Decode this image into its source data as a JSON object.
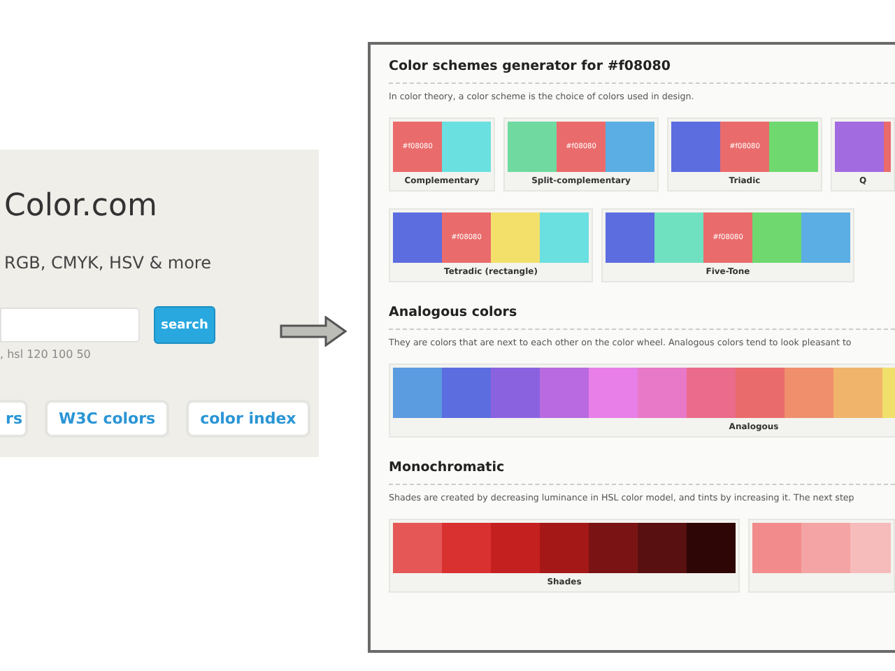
{
  "left_panel": {
    "title": "Color.com",
    "subtitle": "RGB, CMYK, HSV & more",
    "search_hint": ", hsl 120 100 50",
    "search_button": "search",
    "links": [
      "rs",
      "W3C colors",
      "color index"
    ]
  },
  "right_panel": {
    "sections": [
      {
        "heading": "Color schemes generator for #f08080",
        "description": "In color theory, a color scheme is the choice of colors used in design.",
        "card_groups": [
          {
            "cards": [
              {
                "name": "Complementary",
                "swatches": [
                  {
                    "color": "#ea6b6b",
                    "label": "#f08080"
                  },
                  {
                    "color": "#6ae0e0"
                  }
                ]
              },
              {
                "name": "Split-complementary",
                "swatches": [
                  {
                    "color": "#6fd9a0"
                  },
                  {
                    "color": "#ea6b6b",
                    "label": "#f08080"
                  },
                  {
                    "color": "#5aaee3"
                  }
                ]
              },
              {
                "name": "Triadic",
                "swatches": [
                  {
                    "color": "#5c6de0"
                  },
                  {
                    "color": "#ea6b6b",
                    "label": "#f08080"
                  },
                  {
                    "color": "#6fd86f"
                  }
                ]
              },
              {
                "name": "Q",
                "swatches": [
                  {
                    "color": "#a26be0"
                  },
                  {
                    "color": "#ea6b6b"
                  }
                ]
              }
            ]
          },
          {
            "cards": [
              {
                "name": "Tetradic (rectangle)",
                "swatches": [
                  {
                    "color": "#5c6de0"
                  },
                  {
                    "color": "#ea6b6b",
                    "label": "#f08080"
                  },
                  {
                    "color": "#f2e06a"
                  },
                  {
                    "color": "#6ae0e0"
                  }
                ]
              },
              {
                "name": "Five-Tone",
                "swatches": [
                  {
                    "color": "#5c6de0"
                  },
                  {
                    "color": "#6fe0c0"
                  },
                  {
                    "color": "#ea6b6b",
                    "label": "#f08080"
                  },
                  {
                    "color": "#6fd86f"
                  },
                  {
                    "color": "#5aaee3"
                  }
                ]
              }
            ]
          }
        ]
      },
      {
        "heading": "Analogous colors",
        "description": "They are colors that are next to each other on the color wheel. Analogous colors tend to look pleasant to",
        "card_groups": [
          {
            "cards": [
              {
                "name": "Analogous",
                "swatches": [
                  {
                    "color": "#5b9be0"
                  },
                  {
                    "color": "#5c6de0"
                  },
                  {
                    "color": "#8a62e0"
                  },
                  {
                    "color": "#b96ae0"
                  },
                  {
                    "color": "#e87fe8"
                  },
                  {
                    "color": "#e878c8"
                  },
                  {
                    "color": "#ea6b8b"
                  },
                  {
                    "color": "#ea6b6b"
                  },
                  {
                    "color": "#ef8f6b"
                  },
                  {
                    "color": "#f0b46b"
                  },
                  {
                    "color": "#f0e06b"
                  }
                ]
              }
            ]
          }
        ]
      },
      {
        "heading": "Monochromatic",
        "description": "Shades are created by decreasing luminance in HSL color model, and tints by increasing it. The next step",
        "card_groups": [
          {
            "cards": [
              {
                "name": "Shades",
                "swatches": [
                  {
                    "color": "#e55757"
                  },
                  {
                    "color": "#d93030"
                  },
                  {
                    "color": "#c42020"
                  },
                  {
                    "color": "#a51818"
                  },
                  {
                    "color": "#7a1414"
                  },
                  {
                    "color": "#581010"
                  },
                  {
                    "color": "#2e0606"
                  }
                ]
              },
              {
                "swatches": [
                  {
                    "color": "#f28c8c"
                  },
                  {
                    "color": "#f4a4a4"
                  },
                  {
                    "color": "#f6bcbc"
                  }
                ]
              }
            ]
          }
        ]
      }
    ]
  }
}
